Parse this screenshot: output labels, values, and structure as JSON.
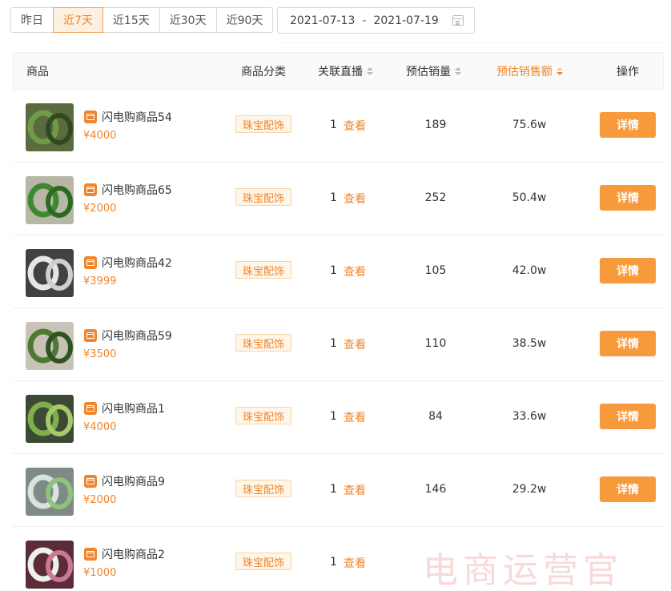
{
  "range_buttons": [
    "昨日",
    "近7天",
    "近15天",
    "近30天",
    "近90天"
  ],
  "date_range": {
    "start": "2021-07-13",
    "separator": "-",
    "end": "2021-07-19"
  },
  "table": {
    "headers": {
      "product": "商品",
      "category": "商品分类",
      "live": "关联直播",
      "sales": "预估销量",
      "amount": "预估销售额",
      "op": "操作"
    },
    "rows": [
      {
        "name": "闪电购商品54",
        "price": "¥4000",
        "category": "珠宝配饰",
        "live_count": "1",
        "live_link": "查看",
        "sales": "189",
        "amount": "75.6w",
        "action": "详情"
      },
      {
        "name": "闪电购商品65",
        "price": "¥2000",
        "category": "珠宝配饰",
        "live_count": "1",
        "live_link": "查看",
        "sales": "252",
        "amount": "50.4w",
        "action": "详情"
      },
      {
        "name": "闪电购商品42",
        "price": "¥3999",
        "category": "珠宝配饰",
        "live_count": "1",
        "live_link": "查看",
        "sales": "105",
        "amount": "42.0w",
        "action": "详情"
      },
      {
        "name": "闪电购商品59",
        "price": "¥3500",
        "category": "珠宝配饰",
        "live_count": "1",
        "live_link": "查看",
        "sales": "110",
        "amount": "38.5w",
        "action": "详情"
      },
      {
        "name": "闪电购商品1",
        "price": "¥4000",
        "category": "珠宝配饰",
        "live_count": "1",
        "live_link": "查看",
        "sales": "84",
        "amount": "33.6w",
        "action": "详情"
      },
      {
        "name": "闪电购商品9",
        "price": "¥2000",
        "category": "珠宝配饰",
        "live_count": "1",
        "live_link": "查看",
        "sales": "146",
        "amount": "29.2w",
        "action": "详情"
      },
      {
        "name": "闪电购商品2",
        "price": "¥1000",
        "category": "珠宝配饰",
        "live_count": "1",
        "live_link": "查看",
        "sales": "",
        "amount": "",
        "action": ""
      }
    ]
  },
  "watermark": "电商运营官"
}
